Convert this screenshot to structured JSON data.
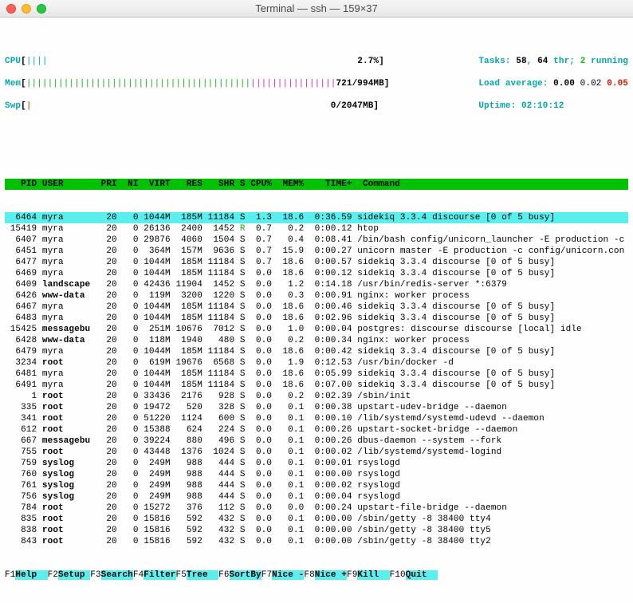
{
  "window": {
    "title": "Terminal — ssh — 159×37"
  },
  "meters": {
    "cpu": {
      "label": "CPU",
      "bar": "||||",
      "value": "2.7%"
    },
    "mem": {
      "label": "Mem",
      "bar_a": "||||||||||||||||||||||||||||||||||||||||||",
      "bar_b": "||||||||||||||||",
      "value": "721/994MB"
    },
    "swp": {
      "label": "Swp",
      "bar": "|",
      "value": "0/2047MB"
    }
  },
  "stats": {
    "tasks_label": "Tasks: ",
    "tasks": "58",
    "thr_sep": ", ",
    "thr": "64",
    "thr_label": " thr; ",
    "running": "2",
    "running_label": " running",
    "load_label": "Load average: ",
    "load1": "0.00",
    "load2": " 0.02 ",
    "load3": "0.05",
    "uptime_label": "Uptime: ",
    "uptime": "02:10:12"
  },
  "columns": [
    "PID",
    "USER",
    "PRI",
    "NI",
    "VIRT",
    "RES",
    "SHR",
    "S",
    "CPU%",
    "MEM%",
    "TIME+",
    "Command"
  ],
  "rows": [
    {
      "pid": "6464",
      "user": "myra",
      "pri": "20",
      "ni": "0",
      "virt": "1044M",
      "res": "185M",
      "shr": "11184",
      "s": "S",
      "cpu": "1.3",
      "mem": "18.6",
      "time": "0:36.59",
      "cmd": "sidekiq 3.3.4 discourse [0 of 5 busy]",
      "hl": true
    },
    {
      "pid": "15419",
      "user": "myra",
      "pri": "20",
      "ni": "0",
      "virt": "26136",
      "res": "2400",
      "shr": "1452",
      "s": "R",
      "cpu": "0.7",
      "mem": "0.2",
      "time": "0:00.12",
      "cmd": "htop",
      "rgreen": true
    },
    {
      "pid": "6407",
      "user": "myra",
      "pri": "20",
      "ni": "0",
      "virt": "29876",
      "res": "4060",
      "shr": "1504",
      "s": "S",
      "cpu": "0.7",
      "mem": "0.4",
      "time": "0:08.41",
      "cmd": "/bin/bash config/unicorn_launcher -E production -c"
    },
    {
      "pid": "6451",
      "user": "myra",
      "pri": "20",
      "ni": "0",
      "virt": "364M",
      "res": "157M",
      "shr": "9636",
      "s": "S",
      "cpu": "0.7",
      "mem": "15.9",
      "time": "0:00.27",
      "cmd": "unicorn master -E production -c config/unicorn.con"
    },
    {
      "pid": "6477",
      "user": "myra",
      "pri": "20",
      "ni": "0",
      "virt": "1044M",
      "res": "185M",
      "shr": "11184",
      "s": "S",
      "cpu": "0.7",
      "mem": "18.6",
      "time": "0:00.57",
      "cmd": "sidekiq 3.3.4 discourse [0 of 5 busy]"
    },
    {
      "pid": "6469",
      "user": "myra",
      "pri": "20",
      "ni": "0",
      "virt": "1044M",
      "res": "185M",
      "shr": "11184",
      "s": "S",
      "cpu": "0.0",
      "mem": "18.6",
      "time": "0:00.12",
      "cmd": "sidekiq 3.3.4 discourse [0 of 5 busy]"
    },
    {
      "pid": "6409",
      "user": "landscape",
      "pri": "20",
      "ni": "0",
      "virt": "42436",
      "res": "11904",
      "shr": "1452",
      "s": "S",
      "cpu": "0.0",
      "mem": "1.2",
      "time": "0:14.18",
      "cmd": "/usr/bin/redis-server *:6379",
      "ubold": true
    },
    {
      "pid": "6426",
      "user": "www-data",
      "pri": "20",
      "ni": "0",
      "virt": "119M",
      "res": "3200",
      "shr": "1220",
      "s": "S",
      "cpu": "0.0",
      "mem": "0.3",
      "time": "0:00.91",
      "cmd": "nginx: worker process",
      "ubold": true
    },
    {
      "pid": "6467",
      "user": "myra",
      "pri": "20",
      "ni": "0",
      "virt": "1044M",
      "res": "185M",
      "shr": "11184",
      "s": "S",
      "cpu": "0.0",
      "mem": "18.6",
      "time": "0:00.46",
      "cmd": "sidekiq 3.3.4 discourse [0 of 5 busy]"
    },
    {
      "pid": "6483",
      "user": "myra",
      "pri": "20",
      "ni": "0",
      "virt": "1044M",
      "res": "185M",
      "shr": "11184",
      "s": "S",
      "cpu": "0.0",
      "mem": "18.6",
      "time": "0:02.96",
      "cmd": "sidekiq 3.3.4 discourse [0 of 5 busy]"
    },
    {
      "pid": "15425",
      "user": "messagebu",
      "pri": "20",
      "ni": "0",
      "virt": "251M",
      "res": "10676",
      "shr": "7012",
      "s": "S",
      "cpu": "0.0",
      "mem": "1.0",
      "time": "0:00.04",
      "cmd": "postgres: discourse discourse [local] idle",
      "ubold": true
    },
    {
      "pid": "6428",
      "user": "www-data",
      "pri": "20",
      "ni": "0",
      "virt": "118M",
      "res": "1940",
      "shr": "480",
      "s": "S",
      "cpu": "0.0",
      "mem": "0.2",
      "time": "0:00.34",
      "cmd": "nginx: worker process",
      "ubold": true
    },
    {
      "pid": "6479",
      "user": "myra",
      "pri": "20",
      "ni": "0",
      "virt": "1044M",
      "res": "185M",
      "shr": "11184",
      "s": "S",
      "cpu": "0.0",
      "mem": "18.6",
      "time": "0:00.42",
      "cmd": "sidekiq 3.3.4 discourse [0 of 5 busy]"
    },
    {
      "pid": "3234",
      "user": "root",
      "pri": "20",
      "ni": "0",
      "virt": "619M",
      "res": "19676",
      "shr": "6568",
      "s": "S",
      "cpu": "0.0",
      "mem": "1.9",
      "time": "0:12.53",
      "cmd": "/usr/bin/docker -d",
      "ubold": true
    },
    {
      "pid": "6481",
      "user": "myra",
      "pri": "20",
      "ni": "0",
      "virt": "1044M",
      "res": "185M",
      "shr": "11184",
      "s": "S",
      "cpu": "0.0",
      "mem": "18.6",
      "time": "0:05.99",
      "cmd": "sidekiq 3.3.4 discourse [0 of 5 busy]"
    },
    {
      "pid": "6491",
      "user": "myra",
      "pri": "20",
      "ni": "0",
      "virt": "1044M",
      "res": "185M",
      "shr": "11184",
      "s": "S",
      "cpu": "0.0",
      "mem": "18.6",
      "time": "0:07.00",
      "cmd": "sidekiq 3.3.4 discourse [0 of 5 busy]"
    },
    {
      "pid": "1",
      "user": "root",
      "pri": "20",
      "ni": "0",
      "virt": "33436",
      "res": "2176",
      "shr": "928",
      "s": "S",
      "cpu": "0.0",
      "mem": "0.2",
      "time": "0:02.39",
      "cmd": "/sbin/init",
      "ubold": true
    },
    {
      "pid": "335",
      "user": "root",
      "pri": "20",
      "ni": "0",
      "virt": "19472",
      "res": "520",
      "shr": "328",
      "s": "S",
      "cpu": "0.0",
      "mem": "0.1",
      "time": "0:00.38",
      "cmd": "upstart-udev-bridge --daemon",
      "ubold": true
    },
    {
      "pid": "341",
      "user": "root",
      "pri": "20",
      "ni": "0",
      "virt": "51220",
      "res": "1124",
      "shr": "600",
      "s": "S",
      "cpu": "0.0",
      "mem": "0.1",
      "time": "0:00.10",
      "cmd": "/lib/systemd/systemd-udevd --daemon",
      "ubold": true
    },
    {
      "pid": "612",
      "user": "root",
      "pri": "20",
      "ni": "0",
      "virt": "15388",
      "res": "624",
      "shr": "224",
      "s": "S",
      "cpu": "0.0",
      "mem": "0.1",
      "time": "0:00.26",
      "cmd": "upstart-socket-bridge --daemon",
      "ubold": true
    },
    {
      "pid": "667",
      "user": "messagebu",
      "pri": "20",
      "ni": "0",
      "virt": "39224",
      "res": "880",
      "shr": "496",
      "s": "S",
      "cpu": "0.0",
      "mem": "0.1",
      "time": "0:00.26",
      "cmd": "dbus-daemon --system --fork",
      "ubold": true
    },
    {
      "pid": "755",
      "user": "root",
      "pri": "20",
      "ni": "0",
      "virt": "43448",
      "res": "1376",
      "shr": "1024",
      "s": "S",
      "cpu": "0.0",
      "mem": "0.1",
      "time": "0:00.02",
      "cmd": "/lib/systemd/systemd-logind",
      "ubold": true
    },
    {
      "pid": "759",
      "user": "syslog",
      "pri": "20",
      "ni": "0",
      "virt": "249M",
      "res": "988",
      "shr": "444",
      "s": "S",
      "cpu": "0.0",
      "mem": "0.1",
      "time": "0:00.01",
      "cmd": "rsyslogd",
      "ubold": true
    },
    {
      "pid": "760",
      "user": "syslog",
      "pri": "20",
      "ni": "0",
      "virt": "249M",
      "res": "988",
      "shr": "444",
      "s": "S",
      "cpu": "0.0",
      "mem": "0.1",
      "time": "0:00.00",
      "cmd": "rsyslogd",
      "ubold": true
    },
    {
      "pid": "761",
      "user": "syslog",
      "pri": "20",
      "ni": "0",
      "virt": "249M",
      "res": "988",
      "shr": "444",
      "s": "S",
      "cpu": "0.0",
      "mem": "0.1",
      "time": "0:00.02",
      "cmd": "rsyslogd",
      "ubold": true
    },
    {
      "pid": "756",
      "user": "syslog",
      "pri": "20",
      "ni": "0",
      "virt": "249M",
      "res": "988",
      "shr": "444",
      "s": "S",
      "cpu": "0.0",
      "mem": "0.1",
      "time": "0:00.04",
      "cmd": "rsyslogd",
      "ubold": true
    },
    {
      "pid": "784",
      "user": "root",
      "pri": "20",
      "ni": "0",
      "virt": "15272",
      "res": "376",
      "shr": "112",
      "s": "S",
      "cpu": "0.0",
      "mem": "0.0",
      "time": "0:00.24",
      "cmd": "upstart-file-bridge --daemon",
      "ubold": true
    },
    {
      "pid": "835",
      "user": "root",
      "pri": "20",
      "ni": "0",
      "virt": "15816",
      "res": "592",
      "shr": "432",
      "s": "S",
      "cpu": "0.0",
      "mem": "0.1",
      "time": "0:00.00",
      "cmd": "/sbin/getty -8 38400 tty4",
      "ubold": true
    },
    {
      "pid": "838",
      "user": "root",
      "pri": "20",
      "ni": "0",
      "virt": "15816",
      "res": "592",
      "shr": "432",
      "s": "S",
      "cpu": "0.0",
      "mem": "0.1",
      "time": "0:00.00",
      "cmd": "/sbin/getty -8 38400 tty5",
      "ubold": true
    },
    {
      "pid": "843",
      "user": "root",
      "pri": "20",
      "ni": "0",
      "virt": "15816",
      "res": "592",
      "shr": "432",
      "s": "S",
      "cpu": "0.0",
      "mem": "0.1",
      "time": "0:00.00",
      "cmd": "/sbin/getty -8 38400 tty2",
      "ubold": true
    }
  ],
  "fnkeys": [
    {
      "k": "F1",
      "l": "Help"
    },
    {
      "k": "F2",
      "l": "Setup"
    },
    {
      "k": "F3",
      "l": "Search"
    },
    {
      "k": "F4",
      "l": "Filter"
    },
    {
      "k": "F5",
      "l": "Tree"
    },
    {
      "k": "F6",
      "l": "SortBy"
    },
    {
      "k": "F7",
      "l": "Nice -"
    },
    {
      "k": "F8",
      "l": "Nice +"
    },
    {
      "k": "F9",
      "l": "Kill"
    },
    {
      "k": "F10",
      "l": "Quit"
    }
  ]
}
